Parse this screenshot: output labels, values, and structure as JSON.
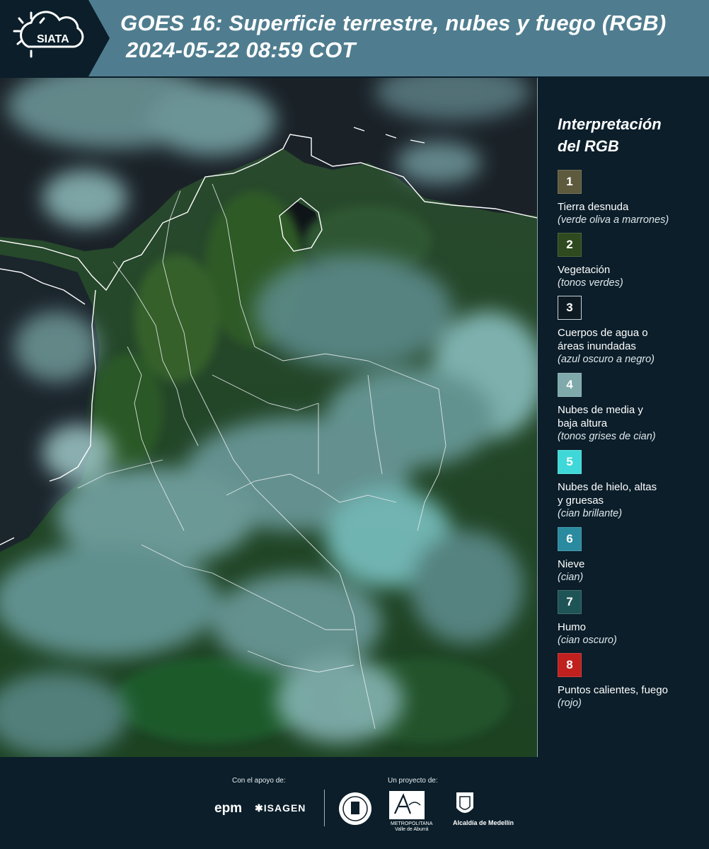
{
  "header": {
    "logo_text": "SIATA",
    "title_line1": "GOES 16: Superficie terrestre, nubes y fuego (RGB)",
    "title_line2": "2024-05-22 08:59 COT"
  },
  "legend": {
    "title_line1": "Interpretación",
    "title_line2": "del RGB",
    "items": [
      {
        "num": "1",
        "label": "Tierra desnuda",
        "hint": "(verde oliva a marrones)",
        "color": "#5e5a3e"
      },
      {
        "num": "2",
        "label": "Vegetación",
        "hint": "(tonos verdes)",
        "color": "#2e4a1e"
      },
      {
        "num": "3",
        "label": "Cuerpos de agua o áreas inundadas",
        "hint": "(azul oscuro a negro)",
        "color": "#0d1a22"
      },
      {
        "num": "4",
        "label": "Nubes de media y baja altura",
        "hint": "(tonos grises de cian)",
        "color": "#7fa9ab"
      },
      {
        "num": "5",
        "label": "Nubes de hielo, altas y gruesas",
        "hint": "(cian brillante)",
        "color": "#3fd8d8"
      },
      {
        "num": "6",
        "label": "Nieve",
        "hint": "(cian)",
        "color": "#2a8aa0"
      },
      {
        "num": "7",
        "label": "Humo",
        "hint": "(cian oscuro)",
        "color": "#1f5456"
      },
      {
        "num": "8",
        "label": "Puntos calientes, fuego",
        "hint": "(rojo)",
        "color": "#c0201e"
      }
    ]
  },
  "footer": {
    "support_label": "Con el apoyo de:",
    "project_label": "Un proyecto de:",
    "epm": "epm",
    "isagen": "ISAGEN",
    "amva_line1": "METROPOLITANA",
    "amva_line2": "Valle de Aburrá",
    "alcaldia": "Alcaldía de Medellín"
  }
}
